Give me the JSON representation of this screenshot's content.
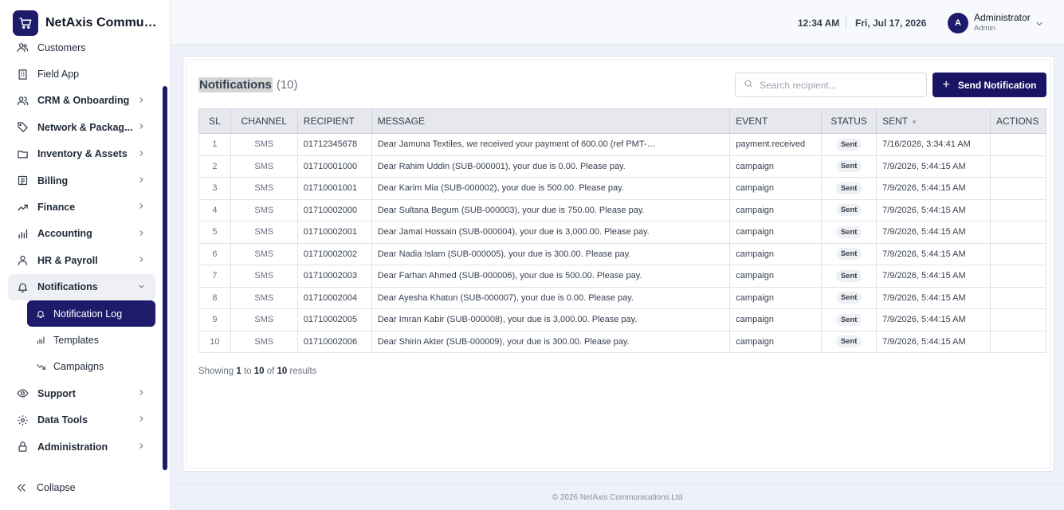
{
  "brand": {
    "name": "NetAxis Communications Ltd",
    "display_name": "NetAxis Communi..."
  },
  "sidebar": {
    "items": [
      {
        "label": "Customers",
        "icon": "users-icon",
        "bold": false
      },
      {
        "label": "Field App",
        "icon": "building-icon",
        "bold": false
      },
      {
        "label": "CRM & Onboarding",
        "icon": "user-group-icon",
        "bold": true
      },
      {
        "label": "Network & Packag...",
        "icon": "tag-icon",
        "bold": true
      },
      {
        "label": "Inventory & Assets",
        "icon": "folder-icon",
        "bold": true
      },
      {
        "label": "Billing",
        "icon": "receipt-icon",
        "bold": true
      },
      {
        "label": "Finance",
        "icon": "trend-icon",
        "bold": true
      },
      {
        "label": "Accounting",
        "icon": "bar-chart-icon",
        "bold": true
      },
      {
        "label": "HR & Payroll",
        "icon": "person-icon",
        "bold": true
      },
      {
        "label": "Notifications",
        "icon": "bell-icon",
        "bold": true
      }
    ],
    "sub_items": [
      {
        "label": "Notification Log",
        "icon": "bell-icon",
        "active": true
      },
      {
        "label": "Templates",
        "icon": "bar-chart-icon",
        "active": false
      },
      {
        "label": "Campaigns",
        "icon": "trend-down-icon",
        "active": false
      }
    ],
    "bottom_items": [
      {
        "label": "Support",
        "icon": "eye-icon"
      },
      {
        "label": "Data Tools",
        "icon": "gear-icon"
      },
      {
        "label": "Administration",
        "icon": "lock-icon"
      }
    ],
    "collapse_label": "Collapse"
  },
  "header": {
    "time": "12:34 AM",
    "date": "Fri, Jul 17, 2026",
    "avatar_letter": "A",
    "user_name": "Administrator",
    "user_role": "Admin"
  },
  "page": {
    "title": "Notifications",
    "count": "(10)",
    "search_placeholder": "Search recipient...",
    "send_button": "Send Notification"
  },
  "table": {
    "columns": [
      "SL",
      "CHANNEL",
      "RECIPIENT",
      "MESSAGE",
      "EVENT",
      "STATUS",
      "SENT",
      "ACTIONS"
    ],
    "rows": [
      {
        "sl": "1",
        "channel": "SMS",
        "recipient": "01712345678",
        "message": "Dear Jamuna Textiles, we received your payment of 600.00 (ref PMT-…",
        "event": "payment.received",
        "status": "Sent",
        "sent": "7/16/2026, 3:34:41 AM"
      },
      {
        "sl": "2",
        "channel": "SMS",
        "recipient": "01710001000",
        "message": "Dear Rahim Uddin (SUB-000001), your due is 0.00. Please pay.",
        "event": "campaign",
        "status": "Sent",
        "sent": "7/9/2026, 5:44:15 AM"
      },
      {
        "sl": "3",
        "channel": "SMS",
        "recipient": "01710001001",
        "message": "Dear Karim Mia (SUB-000002), your due is 500.00. Please pay.",
        "event": "campaign",
        "status": "Sent",
        "sent": "7/9/2026, 5:44:15 AM"
      },
      {
        "sl": "4",
        "channel": "SMS",
        "recipient": "01710002000",
        "message": "Dear Sultana Begum (SUB-000003), your due is 750.00. Please pay.",
        "event": "campaign",
        "status": "Sent",
        "sent": "7/9/2026, 5:44:15 AM"
      },
      {
        "sl": "5",
        "channel": "SMS",
        "recipient": "01710002001",
        "message": "Dear Jamal Hossain (SUB-000004), your due is 3,000.00. Please pay.",
        "event": "campaign",
        "status": "Sent",
        "sent": "7/9/2026, 5:44:15 AM"
      },
      {
        "sl": "6",
        "channel": "SMS",
        "recipient": "01710002002",
        "message": "Dear Nadia Islam (SUB-000005), your due is 300.00. Please pay.",
        "event": "campaign",
        "status": "Sent",
        "sent": "7/9/2026, 5:44:15 AM"
      },
      {
        "sl": "7",
        "channel": "SMS",
        "recipient": "01710002003",
        "message": "Dear Farhan Ahmed (SUB-000006), your due is 500.00. Please pay.",
        "event": "campaign",
        "status": "Sent",
        "sent": "7/9/2026, 5:44:15 AM"
      },
      {
        "sl": "8",
        "channel": "SMS",
        "recipient": "01710002004",
        "message": "Dear Ayesha Khatun (SUB-000007), your due is 0.00. Please pay.",
        "event": "campaign",
        "status": "Sent",
        "sent": "7/9/2026, 5:44:15 AM"
      },
      {
        "sl": "9",
        "channel": "SMS",
        "recipient": "01710002005",
        "message": "Dear Imran Kabir (SUB-000008), your due is 3,000.00. Please pay.",
        "event": "campaign",
        "status": "Sent",
        "sent": "7/9/2026, 5:44:15 AM"
      },
      {
        "sl": "10",
        "channel": "SMS",
        "recipient": "01710002006",
        "message": "Dear Shirin Akter (SUB-000009), your due is 300.00. Please pay.",
        "event": "campaign",
        "status": "Sent",
        "sent": "7/9/2026, 5:44:15 AM"
      }
    ]
  },
  "pagination": {
    "prefix": "Showing",
    "from": "1",
    "to_word": "to",
    "to": "10",
    "of_word": "of",
    "total": "10",
    "suffix": "results"
  },
  "footer": {
    "text": "© 2026 NetAxis Communications Ltd"
  },
  "colors": {
    "accent": "#1e1b6b",
    "background": "#eef1f7"
  }
}
